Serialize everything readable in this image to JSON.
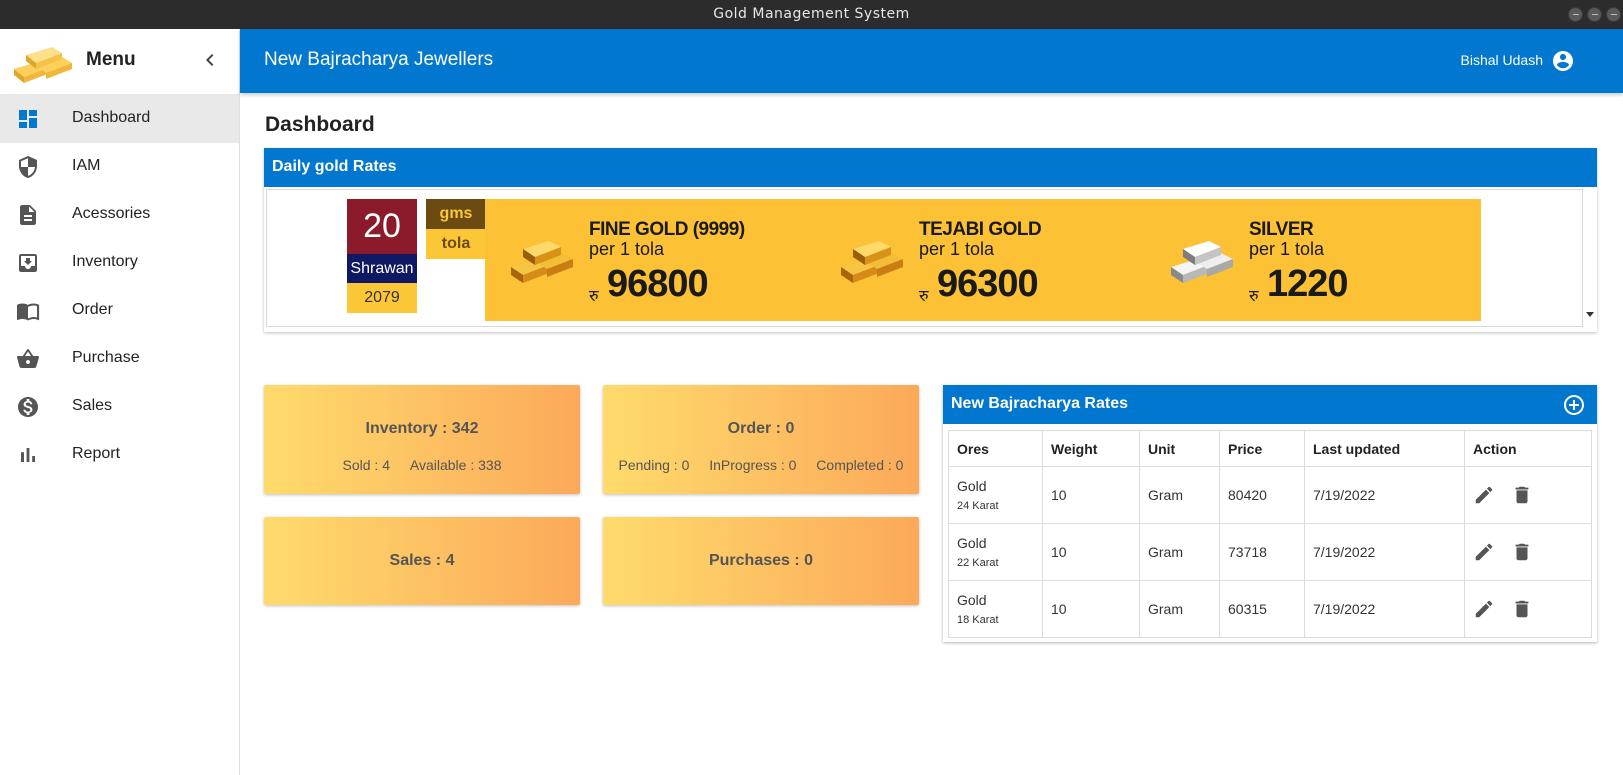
{
  "window": {
    "title": "Gold Management System"
  },
  "sidebar": {
    "title": "Menu",
    "items": [
      {
        "label": "Dashboard",
        "icon": "dashboard-icon",
        "active": true
      },
      {
        "label": "IAM",
        "icon": "shield-icon"
      },
      {
        "label": "Acessories",
        "icon": "document-icon"
      },
      {
        "label": "Inventory",
        "icon": "inbox-tray-icon"
      },
      {
        "label": "Order",
        "icon": "book-icon"
      },
      {
        "label": "Purchase",
        "icon": "basket-icon"
      },
      {
        "label": "Sales",
        "icon": "dollar-circle-icon"
      },
      {
        "label": "Report",
        "icon": "bar-chart-icon"
      }
    ]
  },
  "appbar": {
    "brand": "New Bajracharya Jewellers",
    "user": "Bishal Udash"
  },
  "page": {
    "title": "Dashboard"
  },
  "daily_rates": {
    "title": "Daily gold Rates",
    "date": {
      "day": "20",
      "month": "Shrawan",
      "year": "2079"
    },
    "units": {
      "active": "gms",
      "inactive": "tola"
    },
    "currency": "रु",
    "cards": [
      {
        "name": "FINE GOLD (9999)",
        "unit": "per 1 tola",
        "price": "96800",
        "metal": "gold"
      },
      {
        "name": "TEJABI GOLD",
        "unit": "per 1 tola",
        "price": "96300",
        "metal": "gold"
      },
      {
        "name": "SILVER",
        "unit": "per 1 tola",
        "price": "1220",
        "metal": "silver"
      }
    ]
  },
  "stats": {
    "inventory": {
      "main": "Inventory : 342",
      "sold": "Sold : 4",
      "available": "Available : 338"
    },
    "order": {
      "main": "Order : 0",
      "pending": "Pending : 0",
      "inprogress": "InProgress : 0",
      "completed": "Completed : 0"
    },
    "sales": {
      "main": "Sales : 4"
    },
    "purchases": {
      "main": "Purchases : 0"
    }
  },
  "rates_table": {
    "title": "New Bajracharya Rates",
    "columns": [
      "Ores",
      "Weight",
      "Unit",
      "Price",
      "Last updated",
      "Action"
    ],
    "rows": [
      {
        "ore": "Gold",
        "karat": "24 Karat",
        "weight": "10",
        "unit": "Gram",
        "price": "80420",
        "updated": "7/19/2022"
      },
      {
        "ore": "Gold",
        "karat": "22 Karat",
        "weight": "10",
        "unit": "Gram",
        "price": "73718",
        "updated": "7/19/2022"
      },
      {
        "ore": "Gold",
        "karat": "18 Karat",
        "weight": "10",
        "unit": "Gram",
        "price": "60315",
        "updated": "7/19/2022"
      }
    ]
  },
  "colors": {
    "primary": "#0277cf",
    "gold": "#fcc134",
    "calendar_red": "#8b1a2a",
    "calendar_navy": "#0e1863"
  }
}
